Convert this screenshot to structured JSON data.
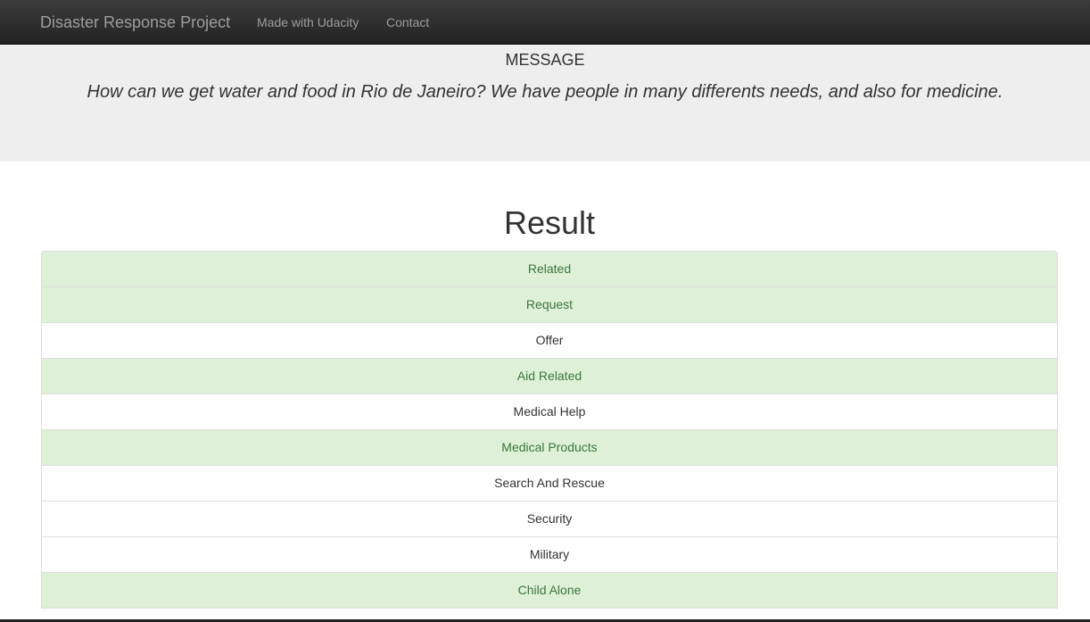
{
  "navbar": {
    "brand": "Disaster Response Project",
    "links": [
      "Made with Udacity",
      "Contact"
    ]
  },
  "message": {
    "label": "MESSAGE",
    "text": "How can we get water and food in Rio de Janeiro? We have people in many differents needs, and also for medicine."
  },
  "result": {
    "title": "Result",
    "categories": [
      {
        "label": "Related",
        "active": true
      },
      {
        "label": "Request",
        "active": true
      },
      {
        "label": "Offer",
        "active": false
      },
      {
        "label": "Aid Related",
        "active": true
      },
      {
        "label": "Medical Help",
        "active": false
      },
      {
        "label": "Medical Products",
        "active": true
      },
      {
        "label": "Search And Rescue",
        "active": false
      },
      {
        "label": "Security",
        "active": false
      },
      {
        "label": "Military",
        "active": false
      },
      {
        "label": "Child Alone",
        "active": true
      }
    ]
  },
  "colors": {
    "navbar_bg": "#222222",
    "jumbotron_bg": "#eeeeee",
    "success_bg": "#dff0d8",
    "success_text": "#3c763d"
  }
}
